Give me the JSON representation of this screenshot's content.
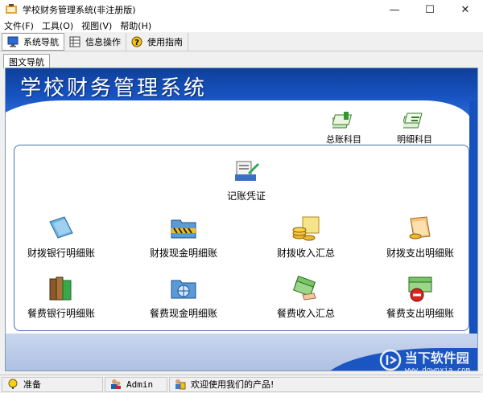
{
  "window": {
    "title": "学校财务管理系统(非注册版)",
    "minimize": "—",
    "maximize": "☐",
    "close": "✕"
  },
  "menu": {
    "items": [
      "文件(F)",
      "工具(O)",
      "视图(V)",
      "帮助(H)"
    ]
  },
  "toolbar": {
    "items": [
      {
        "label": "系统导航",
        "icon": "monitor-icon"
      },
      {
        "label": "信息操作",
        "icon": "table-icon"
      },
      {
        "label": "使用指南",
        "icon": "help-icon"
      }
    ]
  },
  "tabs": {
    "active": "图文导航"
  },
  "banner": {
    "title": "学校财务管理系统"
  },
  "top_icons": [
    {
      "label": "总账科目",
      "icon": "ledger-icon"
    },
    {
      "label": "明细科目",
      "icon": "detail-icon"
    }
  ],
  "voucher": {
    "label": "记账凭证",
    "icon": "voucher-icon"
  },
  "grid": [
    {
      "label": "财拨银行明细账",
      "icon": "bank-book-icon"
    },
    {
      "label": "财拨现金明细账",
      "icon": "cash-folder-icon"
    },
    {
      "label": "财拨收入汇总",
      "icon": "coins-icon"
    },
    {
      "label": "财拨支出明细账",
      "icon": "expense-folder-icon"
    },
    {
      "label": "餐费银行明细账",
      "icon": "books-icon"
    },
    {
      "label": "餐费现金明细账",
      "icon": "globe-folder-icon"
    },
    {
      "label": "餐费收入汇总",
      "icon": "money-hand-icon"
    },
    {
      "label": "餐费支出明细账",
      "icon": "money-stop-icon"
    }
  ],
  "status": {
    "ready": "准备",
    "user": "Admin",
    "welcome": "欢迎使用我们的产品!"
  },
  "watermark": {
    "main": "当下软件园",
    "sub": "www.downxia.com"
  }
}
